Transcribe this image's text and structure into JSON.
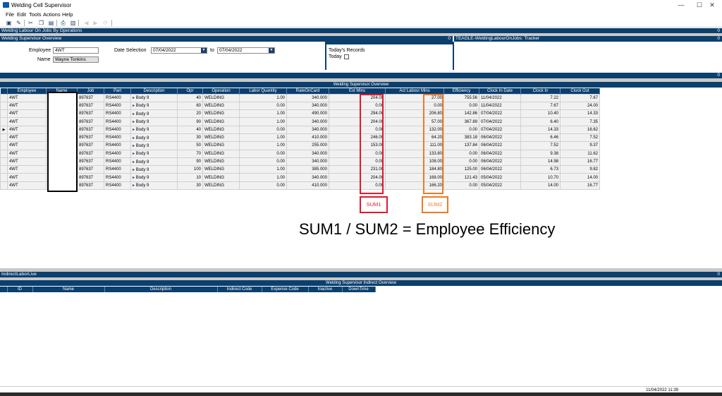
{
  "window": {
    "title": "Welding Cell Supervisor",
    "controls": [
      "—",
      "☐",
      "✕"
    ]
  },
  "menu": [
    "File",
    "Edit",
    "Tools",
    "Actions",
    "Help"
  ],
  "panels": {
    "top_header": "Welding Labour On Jobs By Operations",
    "top_header_num": "0",
    "overview_header": "Welding Supervisor Overview",
    "overview_num": "0",
    "tracker_header": "TEAGLE-WeldingLabourOnJobs: Tracker",
    "mid_num": "0",
    "tracker_num": "0",
    "grid_panel_num": "0"
  },
  "filters": {
    "employee_label": "Employee",
    "employee_value": "4WT",
    "name_label": "Name",
    "name_value": "Wayne Tonkins",
    "date_label": "Date Selection",
    "date_from": "07/04/2022",
    "to_label": "to",
    "date_to": "07/04/2022",
    "todays_records_label": "Today's Records",
    "today_label": "Today"
  },
  "grid": {
    "caption": "Welding Supervisor Overview",
    "columns": [
      "Employee",
      "Name",
      "Job",
      "Part",
      "Description",
      "Opr",
      "Operation",
      "Labor Quantity",
      "RateOnCard",
      "Est Mins",
      "Act Labour Mins",
      "Efficiency",
      "Clock In Date",
      "Clock In",
      "Clock Out"
    ],
    "rows": [
      [
        "4WT",
        "",
        "897637",
        "RS4400",
        "Body 9",
        "40",
        "WELDING",
        "1.00",
        "340.000",
        "204.00",
        "27.00",
        "755.56",
        "11/04/2022",
        "7.22",
        "7.67"
      ],
      [
        "4WT",
        "",
        "897637",
        "RS4400",
        "Body 9",
        "60",
        "WELDING",
        "0.00",
        "340.000",
        "0.00",
        "0.00",
        "0.00",
        "11/04/2022",
        "7.67",
        "24.00"
      ],
      [
        "4WT",
        "",
        "897637",
        "RS4400",
        "Body 9",
        "20",
        "WELDING",
        "1.00",
        "490.000",
        "294.00",
        "206.80",
        "142.86",
        "07/04/2022",
        "10.40",
        "14.33"
      ],
      [
        "4WT",
        "",
        "897637",
        "RS4400",
        "Body 9",
        "90",
        "WELDING",
        "1.00",
        "340.000",
        "204.00",
        "57.00",
        "367.89",
        "07/04/2022",
        "6.40",
        "7.35"
      ],
      [
        "4WT",
        "",
        "897637",
        "RS4400",
        "Body 9",
        "40",
        "WELDING",
        "0.00",
        "340.000",
        "0.00",
        "132.00",
        "0.00",
        "07/04/2022",
        "14.33",
        "16.62"
      ],
      [
        "4WT",
        "",
        "897637",
        "RS4400",
        "Body 9",
        "30",
        "WELDING",
        "1.00",
        "410.000",
        "246.00",
        "64.20",
        "383.18",
        "06/04/2022",
        "6.46",
        "7.52"
      ],
      [
        "4WT",
        "",
        "897637",
        "RS4400",
        "Body 9",
        "50",
        "WELDING",
        "1.00",
        "255.000",
        "153.00",
        "111.00",
        "137.84",
        "06/04/2022",
        "7.52",
        "9.37"
      ],
      [
        "4WT",
        "",
        "897637",
        "RS4400",
        "Body 9",
        "70",
        "WELDING",
        "0.00",
        "340.000",
        "0.00",
        "133.80",
        "0.00",
        "06/04/2022",
        "9.38",
        "11.62"
      ],
      [
        "4WT",
        "",
        "897637",
        "RS4400",
        "Body 9",
        "90",
        "WELDING",
        "0.00",
        "340.000",
        "0.00",
        "108.00",
        "0.00",
        "06/04/2022",
        "14.98",
        "16.77"
      ],
      [
        "4WT",
        "",
        "897637",
        "RS4400",
        "Body 9",
        "100",
        "WELDING",
        "1.00",
        "385.000",
        "231.00",
        "184.80",
        "125.00",
        "06/04/2022",
        "6.73",
        "9.82"
      ],
      [
        "4WT",
        "",
        "897637",
        "RS4400",
        "Body 9",
        "10",
        "WELDING",
        "1.00",
        "340.000",
        "204.00",
        "168.00",
        "121.43",
        "05/04/2022",
        "10.70",
        "14.00"
      ],
      [
        "4WT",
        "",
        "897637",
        "RS4400",
        "Body 9",
        "30",
        "WELDING",
        "0.00",
        "410.000",
        "0.00",
        "166.20",
        "0.00",
        "05/04/2022",
        "14.00",
        "16.77"
      ]
    ]
  },
  "annotations": {
    "sum1": "SUM1",
    "sum2": "SUM2",
    "formula": "SUM1 / SUM2 = Employee Efficiency",
    "sum1_color": "#e0182d",
    "sum2_color": "#ef7a22"
  },
  "indirect": {
    "panel_header": "IndirectLaborLive",
    "panel_num": "0",
    "caption": "Welding Supervisor Indirect Overview",
    "columns": [
      "ID",
      "Name",
      "Description",
      "Indirect Code",
      "Expense Code",
      "Inactive",
      "DownTime"
    ]
  },
  "status": {
    "datetime": "11/04/2022  11:39"
  },
  "colors": {
    "header_bg": "#0b3f6e",
    "accent": "#1b3f6b"
  }
}
